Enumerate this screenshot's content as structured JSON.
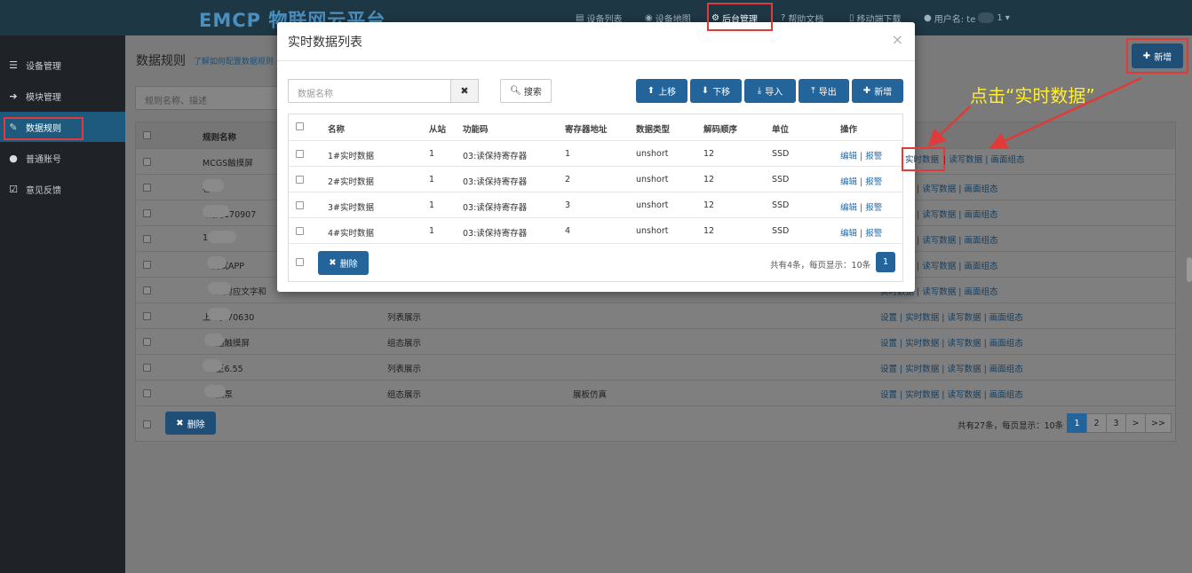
{
  "app": {
    "logo": "EMCP 物联网云平台",
    "nav": [
      {
        "icon": "list-icon",
        "label": "设备列表"
      },
      {
        "icon": "globe-icon",
        "label": "设备地图"
      },
      {
        "icon": "gears-icon",
        "label": "后台管理"
      },
      {
        "icon": "question-icon",
        "label": "帮助文档"
      },
      {
        "icon": "mobile-icon",
        "label": "移动端下载"
      }
    ],
    "user_label": "用户名: te",
    "user_suffix": "1"
  },
  "sidebar": {
    "items": [
      {
        "icon": "th-list-icon",
        "label": "设备管理"
      },
      {
        "icon": "sign-in-icon",
        "label": "模块管理"
      },
      {
        "icon": "pencil-icon",
        "label": "数据规则"
      },
      {
        "icon": "user-icon",
        "label": "普通账号"
      },
      {
        "icon": "edit-icon",
        "label": "意见反馈"
      }
    ]
  },
  "page": {
    "title": "数据规则",
    "help_link": "了解如何配置数据规则",
    "search_placeholder": "规则名称、描述",
    "add_button": "新增",
    "delete_button": "删除",
    "summary": "共有27条，每页显示：10条",
    "pagination": [
      "1",
      "2",
      "3",
      ">",
      ">>"
    ],
    "table": {
      "header_name": "规则名称",
      "rows": [
        {
          "name": "MCGS触摸屏",
          "type": "",
          "desc": ""
        },
        {
          "name": "客",
          "type": "",
          "desc": ""
        },
        {
          "name": "规则170907",
          "type": "",
          "desc": ""
        },
        {
          "name": "1",
          "type": "",
          "desc": ""
        },
        {
          "name": "测试APP",
          "type": "",
          "desc": ""
        },
        {
          "name": "入对应文字和",
          "type": "",
          "desc": ""
        },
        {
          "name": "上 试170630",
          "type": "列表展示",
          "desc": ""
        },
        {
          "name": "通触摸屏",
          "type": "组态展示",
          "desc": ""
        },
        {
          "name": "王6.55",
          "type": "列表展示",
          "desc": ""
        },
        {
          "name": "热泵",
          "type": "组态展示",
          "desc": "展板仿真"
        }
      ],
      "ops": {
        "set": "设置",
        "realtime": "实时数据",
        "readwrite": "读写数据",
        "scada": "画面组态"
      }
    }
  },
  "modal": {
    "title": "实时数据列表",
    "close": "×",
    "search_placeholder": "数据名称",
    "search_button": "搜索",
    "buttons": {
      "up": "上移",
      "down": "下移",
      "import": "导入",
      "export": "导出",
      "add": "新增",
      "delete": "删除"
    },
    "headers": [
      "名称",
      "从站",
      "功能码",
      "寄存器地址",
      "数据类型",
      "解码顺序",
      "单位",
      "操作"
    ],
    "rows": [
      {
        "name": "1#实时数据",
        "slave": "1",
        "func": "03:读保持寄存器",
        "addr": "1",
        "dtype": "unshort",
        "order": "12",
        "unit": "SSD"
      },
      {
        "name": "2#实时数据",
        "slave": "1",
        "func": "03:读保持寄存器",
        "addr": "2",
        "dtype": "unshort",
        "order": "12",
        "unit": "SSD"
      },
      {
        "name": "3#实时数据",
        "slave": "1",
        "func": "03:读保持寄存器",
        "addr": "3",
        "dtype": "unshort",
        "order": "12",
        "unit": "SSD"
      },
      {
        "name": "4#实时数据",
        "slave": "1",
        "func": "03:读保持寄存器",
        "addr": "4",
        "dtype": "unshort",
        "order": "12",
        "unit": "SSD"
      }
    ],
    "ops": {
      "edit": "编辑",
      "alarm": "报警"
    },
    "summary": "共有4条，每页显示：10条",
    "page": "1"
  },
  "annotation": {
    "text": "点击“实时数据”",
    "color": "#ffee33",
    "arrow_color": "#e03a3a"
  }
}
